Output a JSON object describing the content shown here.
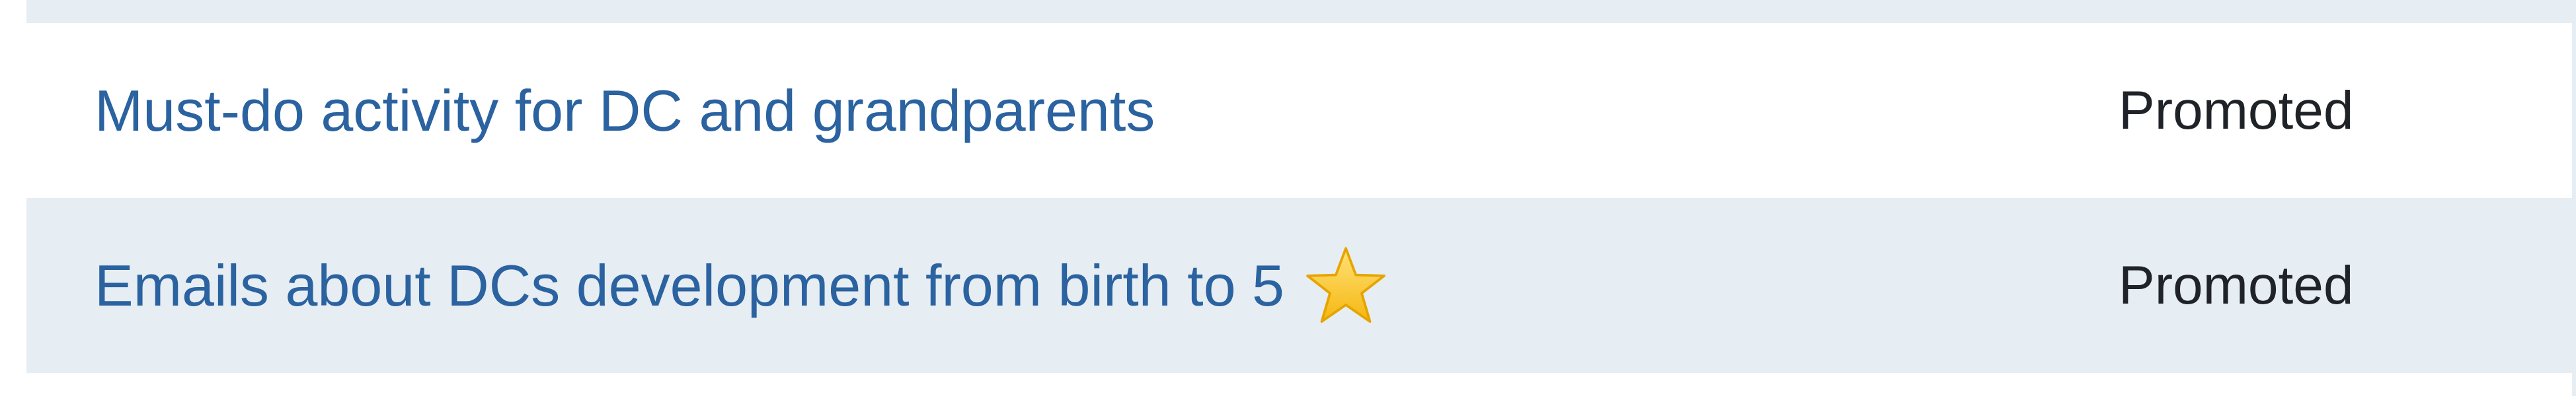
{
  "threads": [
    {
      "title": "Must-do activity for DC and grandparents",
      "status": "Promoted",
      "starred": false
    },
    {
      "title": "Emails about DCs development from birth to 5",
      "status": "Promoted",
      "starred": true,
      "icon": "star-icon"
    }
  ],
  "colors": {
    "link": "#2b62a0",
    "alt_row": "#e6edf3",
    "star": "#f7c531"
  }
}
